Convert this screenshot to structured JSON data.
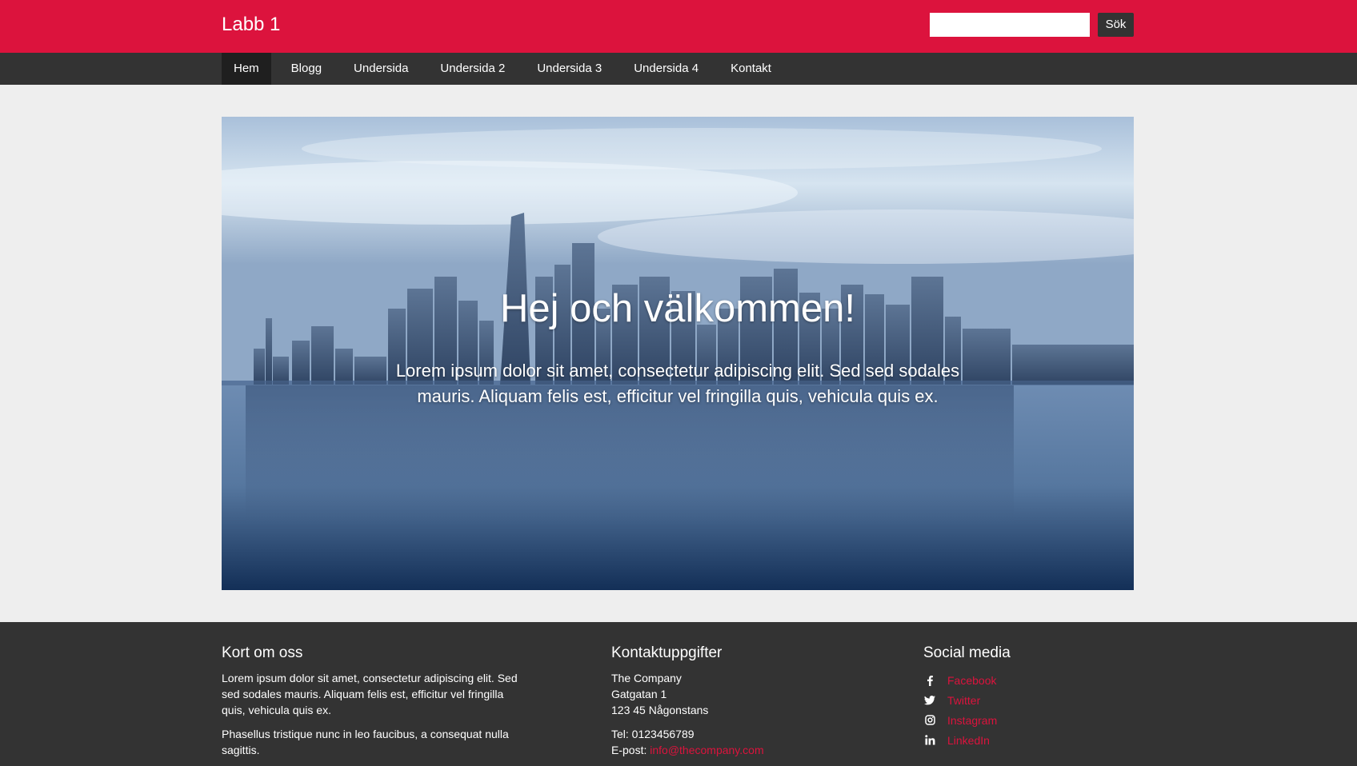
{
  "header": {
    "site_title": "Labb 1",
    "search": {
      "value": "",
      "placeholder": ""
    },
    "search_button_label": "Sök",
    "brand_color": "#dc133d"
  },
  "nav": {
    "items": [
      {
        "label": "Hem",
        "active": true
      },
      {
        "label": "Blogg",
        "active": false
      },
      {
        "label": "Undersida",
        "active": false
      },
      {
        "label": "Undersida 2",
        "active": false
      },
      {
        "label": "Undersida 3",
        "active": false
      },
      {
        "label": "Undersida 4",
        "active": false
      },
      {
        "label": "Kontakt",
        "active": false
      }
    ]
  },
  "hero": {
    "title": "Hej och välkommen!",
    "text": "Lorem ipsum dolor sit amet, consectetur adipiscing elit. Sed sed sodales mauris. Aliquam felis est, efficitur vel fringilla quis, vehicula quis ex."
  },
  "footer": {
    "about": {
      "heading": "Kort om oss",
      "paragraph1": "Lorem ipsum dolor sit amet, consectetur adipiscing elit. Sed sed sodales mauris. Aliquam felis est, efficitur vel fringilla quis, vehicula quis ex.",
      "paragraph2": "Phasellus tristique nunc in leo faucibus, a consequat nulla sagittis."
    },
    "contact": {
      "heading": "Kontaktuppgifter",
      "company": "The Company",
      "street": "Gatgatan 1",
      "postal": "123 45 Någonstans",
      "phone": "Tel: 0123456789",
      "email_label": "E-post:",
      "email": "info@thecompany.com"
    },
    "social": {
      "heading": "Social media",
      "items": [
        {
          "label": "Facebook",
          "icon": "facebook-icon"
        },
        {
          "label": "Twitter",
          "icon": "twitter-icon"
        },
        {
          "label": "Instagram",
          "icon": "instagram-icon"
        },
        {
          "label": "LinkedIn",
          "icon": "linkedin-icon"
        }
      ]
    }
  }
}
